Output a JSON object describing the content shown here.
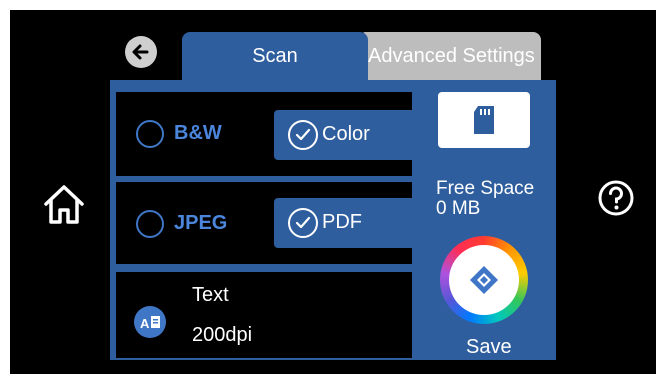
{
  "tabs": {
    "scan": "Scan",
    "advanced": "Advanced Settings"
  },
  "color_mode": {
    "option_bw": "B&W",
    "option_color": "Color",
    "selected": "Color"
  },
  "file_format": {
    "option_jpeg": "JPEG",
    "option_pdf": "PDF",
    "selected": "PDF"
  },
  "scan_type": {
    "line1": "Text",
    "line2": "200dpi"
  },
  "storage": {
    "free_label": "Free Space",
    "free_value": "0 MB"
  },
  "actions": {
    "save_label": "Save"
  },
  "colors": {
    "panel": "#2f5e9e",
    "accent_text": "#4b86dc",
    "background": "#000000"
  },
  "icons": [
    "back-arrow-icon",
    "home-icon",
    "help-icon",
    "memory-card-icon",
    "save-diamond-icon",
    "text-scan-icon",
    "check-icon"
  ]
}
